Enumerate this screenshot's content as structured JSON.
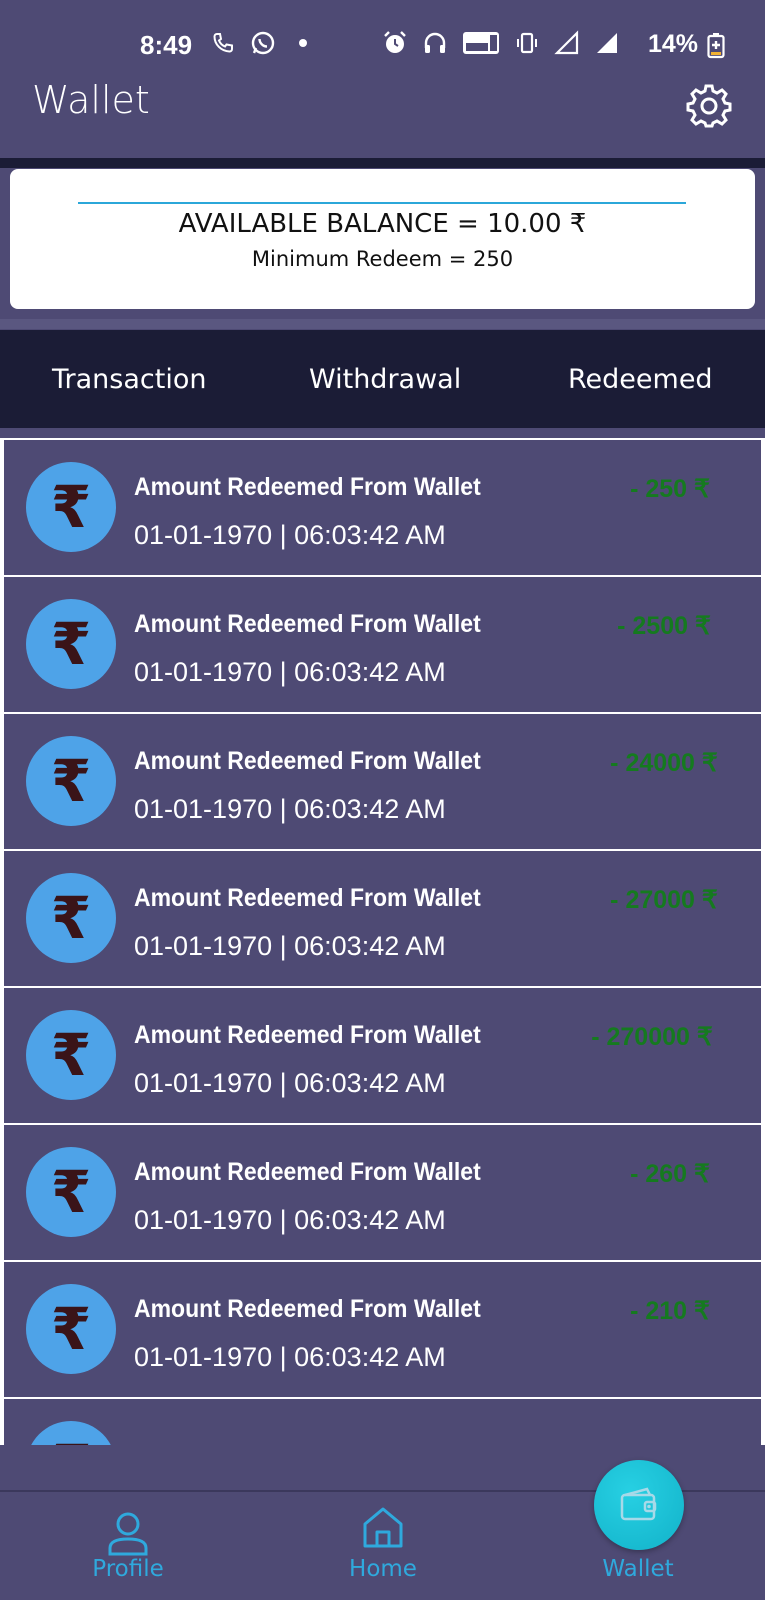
{
  "status_bar": {
    "time": "8:49",
    "battery": "14%"
  },
  "header": {
    "title": "Wallet",
    "settings_icon": "gear-icon"
  },
  "balance": {
    "available": "AVAILABLE BALANCE = 10.00 ₹",
    "min_redeem": "Minimum Redeem = 250"
  },
  "tabs": [
    {
      "label": "Transaction"
    },
    {
      "label": "Withdrawal"
    },
    {
      "label": "Redeemed"
    }
  ],
  "transactions": [
    {
      "title": "Amount Redeemed From Wallet",
      "date": "01-01-1970 | 06:03:42 AM",
      "amount": "- 250 ₹"
    },
    {
      "title": "Amount Redeemed From Wallet",
      "date": "01-01-1970 | 06:03:42 AM",
      "amount": "- 2500 ₹"
    },
    {
      "title": "Amount Redeemed From Wallet",
      "date": "01-01-1970 | 06:03:42 AM",
      "amount": "- 24000 ₹"
    },
    {
      "title": "Amount Redeemed From Wallet",
      "date": "01-01-1970 | 06:03:42 AM",
      "amount": "- 27000 ₹"
    },
    {
      "title": "Amount Redeemed From Wallet",
      "date": "01-01-1970 | 06:03:42 AM",
      "amount": "- 270000 ₹"
    },
    {
      "title": "Amount Redeemed From Wallet",
      "date": "01-01-1970 | 06:03:42 AM",
      "amount": "- 260 ₹"
    },
    {
      "title": "Amount Redeemed From Wallet",
      "date": "01-01-1970 | 06:03:42 AM",
      "amount": "- 210 ₹"
    }
  ],
  "coin_symbol": "₹",
  "colors": {
    "background": "#4e4a74",
    "tab_bar": "#1b1c36",
    "amount_green": "#157a1f",
    "coin_blue": "#4ea3e8",
    "nav_accent": "#2fa9dd"
  },
  "bottom_nav": {
    "profile": "Profile",
    "home": "Home",
    "wallet": "Wallet"
  }
}
